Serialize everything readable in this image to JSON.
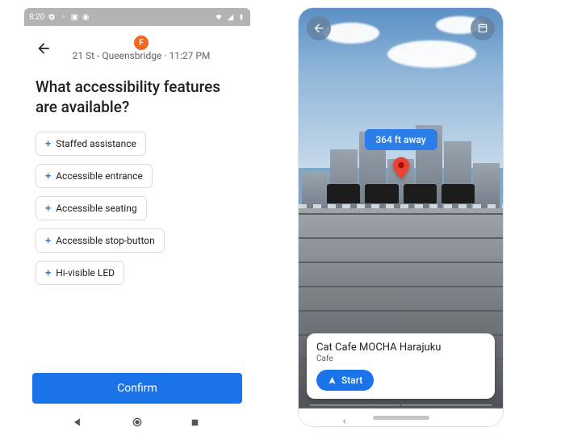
{
  "left": {
    "statusbar": {
      "time": "8:20"
    },
    "header": {
      "line_letter": "F",
      "station": "21 St - Queensbridge",
      "time": "11:27 PM"
    },
    "question": "What accessibility features are available?",
    "options": [
      "Staffed assistance",
      "Accessible entrance",
      "Accessible seating",
      "Accessible stop-button",
      "Hi-visible LED"
    ],
    "confirm_label": "Confirm"
  },
  "right": {
    "distance_label": "364 ft away",
    "place": {
      "name": "Cat Cafe MOCHA Harajuku",
      "type": "Cafe"
    },
    "start_label": "Start"
  }
}
